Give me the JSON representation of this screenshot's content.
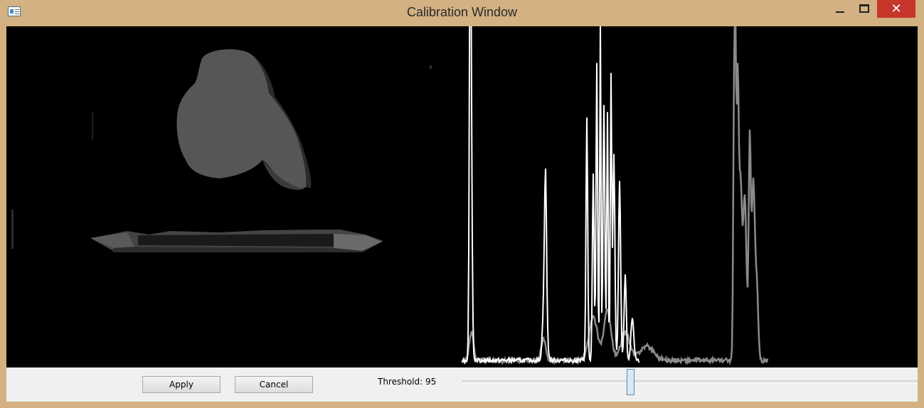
{
  "window": {
    "title": "Calibration Window",
    "icon": "app-window-icon",
    "controls": {
      "minimize": "minimize-icon",
      "maximize": "maximize-icon",
      "close_glyph": "✕"
    },
    "frame_color": "#d3b183"
  },
  "controls": {
    "apply_label": "Apply",
    "cancel_label": "Cancel",
    "threshold_label": "Threshold: 95",
    "threshold_value": 95
  },
  "colors": {
    "histogram_primary": "#ffffff",
    "histogram_secondary": "#8a8a8a",
    "depth_object": "#555555",
    "close_button": "#c7352b"
  }
}
